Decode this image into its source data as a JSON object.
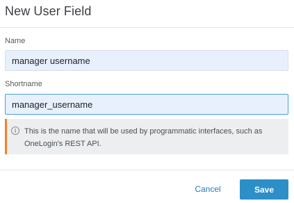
{
  "dialog": {
    "title": "New User Field"
  },
  "fields": {
    "name": {
      "label": "Name",
      "value": "manager username"
    },
    "shortname": {
      "label": "Shortname",
      "value": "manager_username"
    }
  },
  "info": {
    "icon": "info-icon",
    "icon_glyph": "i",
    "text": "This is the name that will be used by programmatic interfaces, such as OneLogin's REST API.",
    "accent_color": "#f5822a"
  },
  "footer": {
    "cancel_label": "Cancel",
    "save_label": "Save",
    "save_color": "#2d8fc8"
  }
}
